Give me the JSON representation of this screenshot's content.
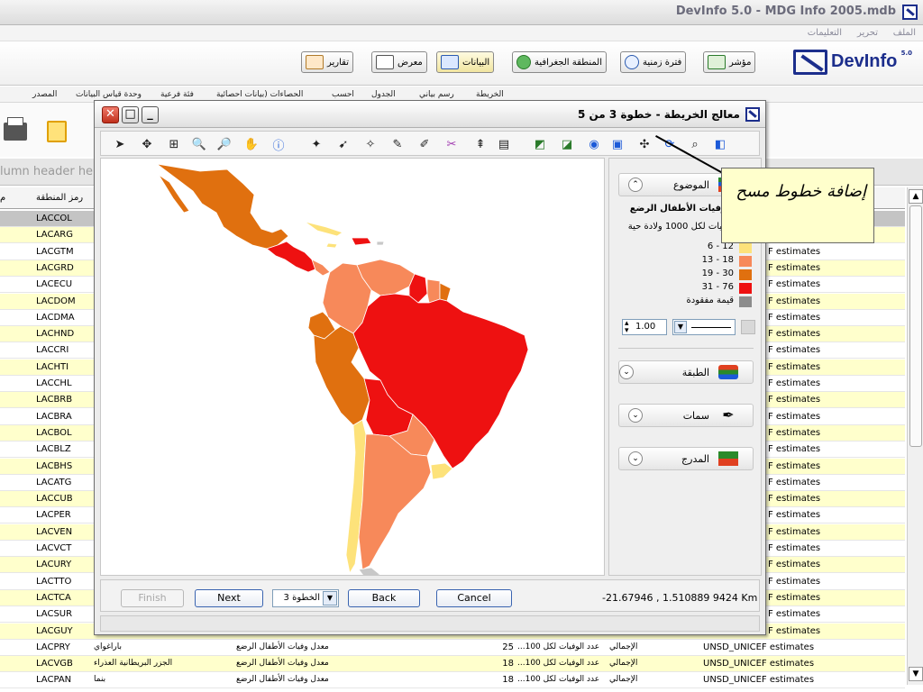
{
  "app": {
    "title": "DevInfo 5.0 - MDG Info 2005.mdb",
    "menu": [
      "الملف",
      "تحرير",
      "التعليمات"
    ],
    "logo_text": "DevInfo",
    "logo_version": "5.0"
  },
  "toolbar": {
    "indicator": "مؤشر",
    "time_period": "فترة زمنية",
    "area": "المنطقة الجغرافية",
    "data": "البيانات",
    "gallery": "معرض",
    "reports": "تقارير"
  },
  "sub_toolbar": [
    "الخريطة",
    "رسم بياني",
    "الجدول",
    "احسب",
    "الحصاءات (بيانات احصائية",
    "فئة فرعية",
    "وحدة قياس البيانات",
    "المصدر"
  ],
  "group_bar": {
    "text": "lumn header here"
  },
  "grid": {
    "headers": {
      "area_code": "رمز المنطقة",
      "left_stub": "م"
    },
    "rows": [
      {
        "code": "LACCOL",
        "src": "F estimates"
      },
      {
        "code": "LACARG",
        "src": "F estimates"
      },
      {
        "code": "LACGTM",
        "src": "F estimates"
      },
      {
        "code": "LACGRD",
        "src": "F estimates"
      },
      {
        "code": "LACECU",
        "src": "F estimates"
      },
      {
        "code": "LACDOM",
        "src": "F estimates"
      },
      {
        "code": "LACDMA",
        "src": "F estimates"
      },
      {
        "code": "LACHND",
        "src": "F estimates"
      },
      {
        "code": "LACCRI",
        "src": "F estimates"
      },
      {
        "code": "LACHTI",
        "src": "F estimates"
      },
      {
        "code": "LACCHL",
        "src": "F estimates"
      },
      {
        "code": "LACBRB",
        "src": "F estimates"
      },
      {
        "code": "LACBRA",
        "src": "F estimates"
      },
      {
        "code": "LACBOL",
        "src": "F estimates"
      },
      {
        "code": "LACBLZ",
        "src": "F estimates"
      },
      {
        "code": "LACBHS",
        "src": "F estimates"
      },
      {
        "code": "LACATG",
        "src": "F estimates"
      },
      {
        "code": "LACCUB",
        "src": "F estimates"
      },
      {
        "code": "LACPER",
        "src": "F estimates"
      },
      {
        "code": "LACVEN",
        "src": "F estimates"
      },
      {
        "code": "LACVCT",
        "src": "F estimates"
      },
      {
        "code": "LACURY",
        "src": "F estimates"
      },
      {
        "code": "LACTTO",
        "src": "F estimates"
      },
      {
        "code": "LACTCA",
        "src": "F estimates"
      },
      {
        "code": "LACSUR",
        "src": "F estimates"
      },
      {
        "code": "LACGUY",
        "src": "F estimates"
      }
    ],
    "full_rows": [
      {
        "code": "LACPRY",
        "name": "باراغواي",
        "indicator": "معدل وفيات الأطفال الرضع",
        "value": "25",
        "unit": "...عدد الوفيات لكل 100",
        "subgroup": "الإجمالي",
        "source": "UNSD_UNICEF estimates"
      },
      {
        "code": "LACVGB",
        "name": "الجزر البريطانية العذراء",
        "indicator": "معدل وفيات الأطفال الرضع",
        "value": "18",
        "unit": "...عدد الوفيات لكل 100",
        "subgroup": "الإجمالي",
        "source": "UNSD_UNICEF estimates"
      },
      {
        "code": "LACPAN",
        "name": "بنما",
        "indicator": "معدل وفيات الأطفال الرضع",
        "value": "18",
        "unit": "...عدد الوفيات لكل 100",
        "subgroup": "الإجمالي",
        "source": "UNSD_UNICEF estimates"
      }
    ]
  },
  "dialog": {
    "title": "معالج الخريطة - خطوة 3 من 5",
    "panel": {
      "theme_label": "الموضوع",
      "indicator_name": "معدل وفيات الأطفال الرضع",
      "unit_name": "عدد الوفيات لكل 1000 ولادة حية",
      "legend": [
        {
          "label": "12 - 6",
          "color": "#fde27a"
        },
        {
          "label": "18 - 13",
          "color": "#f7895a"
        },
        {
          "label": "30 - 19",
          "color": "#e0700f"
        },
        {
          "label": "76 - 31",
          "color": "#ee1111"
        },
        {
          "label": "قيمة مفقودة",
          "color": "#8c8c8c"
        }
      ],
      "line_width": "1.00",
      "layer_label": "الطبقة",
      "features_label": "سمات",
      "scale_label": "المدرج"
    },
    "footer": {
      "finish": "Finish",
      "next": "Next",
      "step": "الخطوة 3",
      "back": "Back",
      "cancel": "Cancel",
      "coords": "-21.67946 , 1.510889  9424 Km"
    }
  },
  "callout": {
    "text": "إضافة خطوط مسح"
  },
  "map_colors": {
    "light": "#fde27a",
    "salmon": "#f7895a",
    "orange": "#e0700f",
    "red": "#ee1111",
    "gray": "#c8c8c8"
  }
}
